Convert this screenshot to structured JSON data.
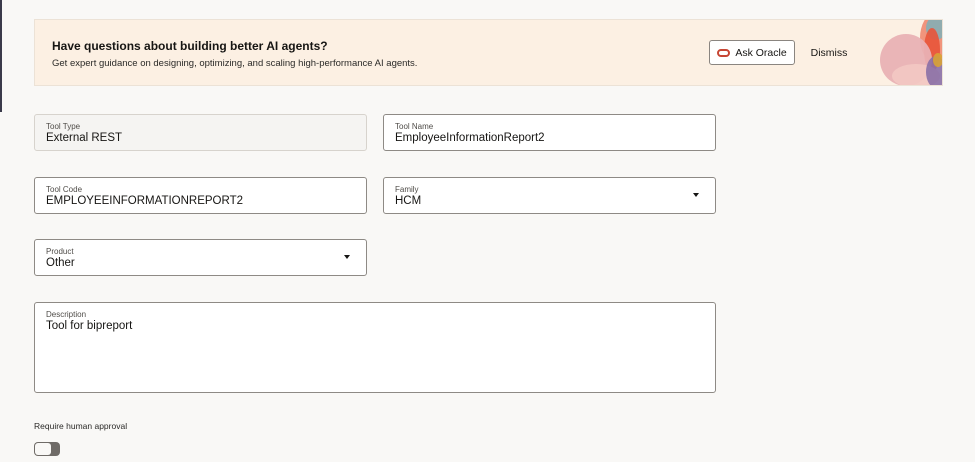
{
  "banner": {
    "title": "Have questions about building better AI agents?",
    "subtitle": "Get expert guidance on designing, optimizing, and scaling high-performance AI agents.",
    "ask_label": "Ask Oracle",
    "dismiss_label": "Dismiss"
  },
  "form": {
    "tool_type": {
      "label": "Tool Type",
      "value": "External REST"
    },
    "tool_name": {
      "label": "Tool Name",
      "value": "EmployeeInformationReport2"
    },
    "tool_code": {
      "label": "Tool Code",
      "value": "EMPLOYEEINFORMATIONREPORT2"
    },
    "family": {
      "label": "Family",
      "value": "HCM"
    },
    "product": {
      "label": "Product",
      "value": "Other"
    },
    "description": {
      "label": "Description",
      "value": "Tool for bipreport"
    },
    "approval": {
      "label": "Require human approval",
      "enabled": false
    }
  },
  "colors": {
    "banner_bg": "#fcf0e3",
    "oracle_red": "#c74634",
    "toggle_off": "#6f6b67"
  }
}
